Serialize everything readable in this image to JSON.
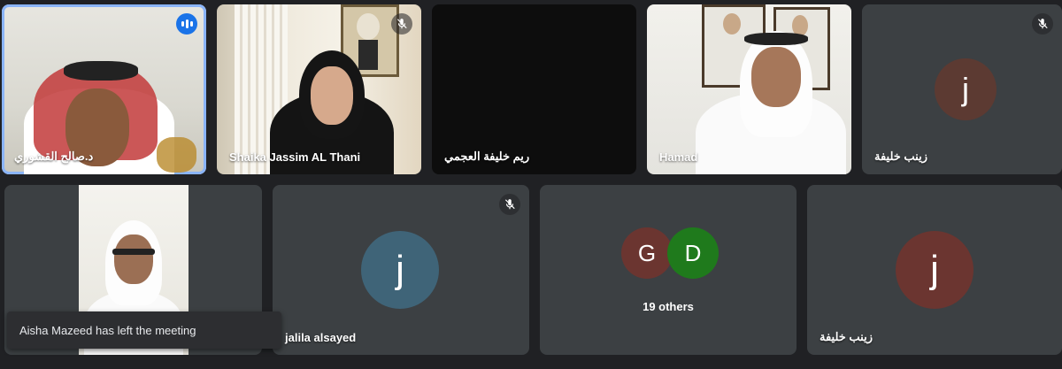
{
  "tiles": [
    {
      "name": "د.صالح القشوري",
      "state": "speaking"
    },
    {
      "name": "Shaika Jassim AL Thani",
      "state": "muted"
    },
    {
      "name": "ريم خليفة العجمي",
      "state": "video-off"
    },
    {
      "name": "Hamad",
      "state": "video"
    },
    {
      "name": "زينب خليفة",
      "initial": "j",
      "avatar_color": "#5c3a32",
      "state": "muted"
    },
    {
      "name": "",
      "state": "video"
    },
    {
      "name": "jalila alsayed",
      "initial": "j",
      "avatar_color": "#3f6478",
      "state": "muted"
    },
    {
      "others_label": "19 others",
      "avatars": [
        {
          "letter": "G",
          "color": "#6b3530"
        },
        {
          "letter": "D",
          "color": "#1f7a1c"
        }
      ]
    },
    {
      "name": "زينب خليفة",
      "initial": "j",
      "avatar_color": "#6b3530"
    }
  ],
  "toast": {
    "message": "Aisha Mazeed has left the meeting"
  },
  "colors": {
    "background": "#202124",
    "tile": "#3c4043",
    "active_border": "#8ab4f8",
    "speaking": "#1a73e8"
  }
}
